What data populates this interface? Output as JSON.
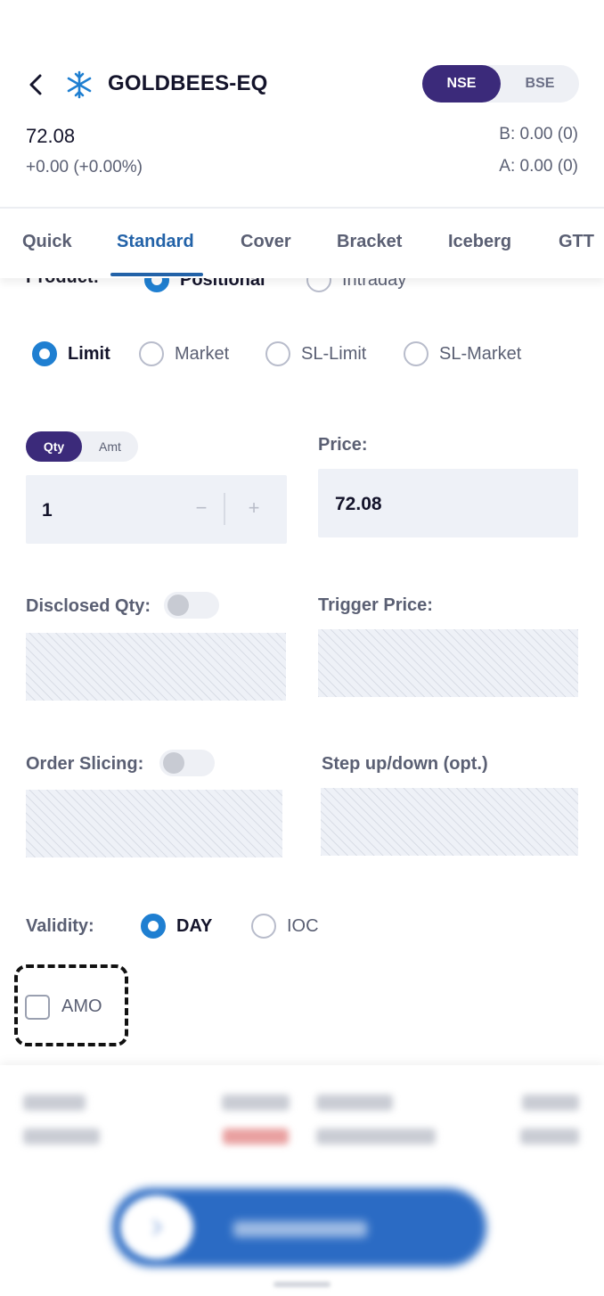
{
  "header": {
    "symbol": "GOLDBEES-EQ",
    "exchanges": [
      "NSE",
      "BSE"
    ],
    "selected_exchange": "NSE",
    "ltp": "72.08",
    "change": "+0.00 (+0.00%)",
    "bid": "B: 0.00 (0)",
    "ask": "A: 0.00 (0)"
  },
  "tabs": {
    "items": [
      "Quick",
      "Standard",
      "Cover",
      "Bracket",
      "Iceberg",
      "GTT"
    ],
    "active": "Standard"
  },
  "product": {
    "label": "Product:",
    "options": [
      "Positional",
      "Intraday"
    ],
    "selected": "Positional"
  },
  "order_type": {
    "options": [
      "Limit",
      "Market",
      "SL-Limit",
      "SL-Market"
    ],
    "selected": "Limit"
  },
  "quantity": {
    "modes": [
      "Qty",
      "Amt"
    ],
    "selected_mode": "Qty",
    "value": "1",
    "minus": "−",
    "plus": "+"
  },
  "price": {
    "label": "Price:",
    "value": "72.08"
  },
  "disclosed_qty": {
    "label": "Disclosed Qty:",
    "enabled": false
  },
  "trigger_price": {
    "label": "Trigger Price:"
  },
  "order_slicing": {
    "label": "Order Slicing:",
    "enabled": false
  },
  "step": {
    "label": "Step up/down (opt.)"
  },
  "validity": {
    "label": "Validity:",
    "options": [
      "DAY",
      "IOC"
    ],
    "selected": "DAY"
  },
  "amo": {
    "label": "AMO",
    "checked": false
  },
  "colors": {
    "accent_blue": "#2262a8",
    "radio_blue": "#1f7fd1",
    "toggle_purple": "#3b2a7a",
    "swipe_blue": "#2b6bc4"
  }
}
